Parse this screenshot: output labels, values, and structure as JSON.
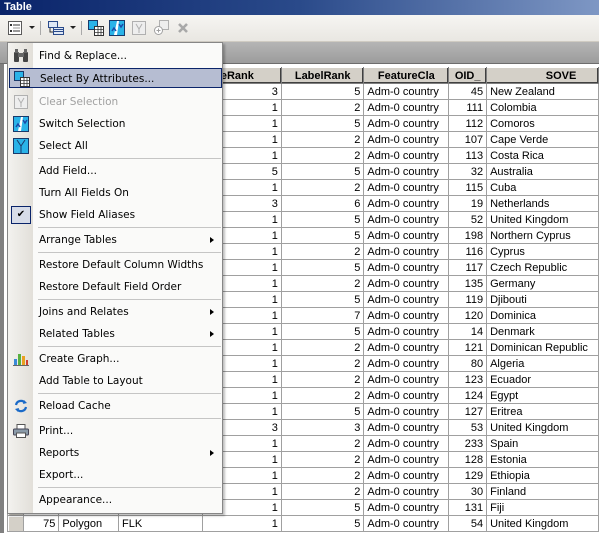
{
  "window": {
    "title": "Table"
  },
  "toolbar": {
    "buttons": [
      {
        "name": "table-options-icon",
        "enabled": true,
        "dropdown": true
      },
      {
        "name": "related-tables-icon",
        "enabled": true,
        "dropdown": true
      },
      {
        "name": "select-by-attributes-icon",
        "enabled": true
      },
      {
        "name": "switch-selection-icon",
        "enabled": true
      },
      {
        "name": "clear-selection-icon",
        "enabled": false
      },
      {
        "name": "zoom-to-selected-icon",
        "enabled": false
      },
      {
        "name": "delete-selected-icon",
        "enabled": false
      }
    ]
  },
  "menu": {
    "items": [
      {
        "label": "Find & Replace...",
        "icon": "binoculars-icon"
      },
      {
        "label": "Select By Attributes...",
        "icon": "select-by-attributes-icon",
        "highlighted": true
      },
      {
        "label": "Clear Selection",
        "icon": "clear-selection-icon",
        "disabled": true
      },
      {
        "label": "Switch Selection",
        "icon": "switch-selection-icon"
      },
      {
        "label": "Select All",
        "icon": "select-all-icon"
      },
      {
        "label": "Add Field..."
      },
      {
        "label": "Turn All Fields On"
      },
      {
        "label": "Show Field Aliases",
        "checked": true
      },
      {
        "label": "Arrange Tables",
        "submenu": true
      },
      {
        "label": "Restore Default Column Widths"
      },
      {
        "label": "Restore Default Field Order"
      },
      {
        "label": "Joins and Relates",
        "submenu": true
      },
      {
        "label": "Related Tables",
        "submenu": true
      },
      {
        "label": "Create Graph...",
        "icon": "bar-chart-icon"
      },
      {
        "label": "Add Table to Layout"
      },
      {
        "label": "Reload Cache",
        "icon": "reload-icon"
      },
      {
        "label": "Print...",
        "icon": "printer-icon"
      },
      {
        "label": "Reports",
        "submenu": true
      },
      {
        "label": "Export..."
      },
      {
        "label": "Appearance..."
      }
    ]
  },
  "table": {
    "columns": [
      "",
      "",
      "",
      "",
      "caleRank",
      "LabelRank",
      "FeatureCla",
      "OID_",
      "SOVE"
    ],
    "rows": [
      [
        "",
        "",
        "",
        "3",
        "5",
        "Adm-0 country",
        "45",
        "New Zealand"
      ],
      [
        "",
        "",
        "",
        "1",
        "2",
        "Adm-0 country",
        "111",
        "Colombia"
      ],
      [
        "",
        "",
        "",
        "1",
        "5",
        "Adm-0 country",
        "112",
        "Comoros"
      ],
      [
        "",
        "",
        "",
        "1",
        "2",
        "Adm-0 country",
        "107",
        "Cape Verde"
      ],
      [
        "",
        "",
        "",
        "1",
        "2",
        "Adm-0 country",
        "113",
        "Costa Rica"
      ],
      [
        "",
        "",
        "",
        "5",
        "5",
        "Adm-0 country",
        "32",
        "Australia"
      ],
      [
        "",
        "",
        "",
        "1",
        "2",
        "Adm-0 country",
        "115",
        "Cuba"
      ],
      [
        "",
        "",
        "",
        "3",
        "6",
        "Adm-0 country",
        "19",
        "Netherlands"
      ],
      [
        "",
        "",
        "",
        "1",
        "5",
        "Adm-0 country",
        "52",
        "United Kingdom"
      ],
      [
        "",
        "",
        "",
        "1",
        "5",
        "Adm-0 country",
        "198",
        "Northern Cyprus"
      ],
      [
        "",
        "",
        "",
        "1",
        "2",
        "Adm-0 country",
        "116",
        "Cyprus"
      ],
      [
        "",
        "",
        "",
        "1",
        "5",
        "Adm-0 country",
        "117",
        "Czech Republic"
      ],
      [
        "",
        "",
        "",
        "1",
        "2",
        "Adm-0 country",
        "135",
        "Germany"
      ],
      [
        "",
        "",
        "",
        "1",
        "5",
        "Adm-0 country",
        "119",
        "Djibouti"
      ],
      [
        "",
        "",
        "",
        "1",
        "7",
        "Adm-0 country",
        "120",
        "Dominica"
      ],
      [
        "",
        "",
        "",
        "1",
        "5",
        "Adm-0 country",
        "14",
        "Denmark"
      ],
      [
        "",
        "",
        "",
        "1",
        "2",
        "Adm-0 country",
        "121",
        "Dominican Republic"
      ],
      [
        "",
        "",
        "",
        "1",
        "2",
        "Adm-0 country",
        "80",
        "Algeria"
      ],
      [
        "",
        "",
        "",
        "1",
        "2",
        "Adm-0 country",
        "123",
        "Ecuador"
      ],
      [
        "",
        "",
        "",
        "1",
        "2",
        "Adm-0 country",
        "124",
        "Egypt"
      ],
      [
        "",
        "",
        "",
        "1",
        "5",
        "Adm-0 country",
        "127",
        "Eritrea"
      ],
      [
        "",
        "",
        "",
        "3",
        "3",
        "Adm-0 country",
        "53",
        "United Kingdom"
      ],
      [
        "",
        "",
        "",
        "1",
        "2",
        "Adm-0 country",
        "233",
        "Spain"
      ],
      [
        "",
        "",
        "",
        "1",
        "2",
        "Adm-0 country",
        "128",
        "Estonia"
      ],
      [
        "",
        "",
        "",
        "1",
        "2",
        "Adm-0 country",
        "129",
        "Ethiopia"
      ],
      [
        "",
        "",
        "",
        "1",
        "2",
        "Adm-0 country",
        "30",
        "Finland"
      ],
      [
        "",
        "",
        "",
        "1",
        "5",
        "Adm-0 country",
        "131",
        "Fiji"
      ],
      [
        "75",
        "Polygon",
        "FLK",
        "1",
        "5",
        "Adm-0 country",
        "54",
        "United Kingdom"
      ]
    ]
  }
}
